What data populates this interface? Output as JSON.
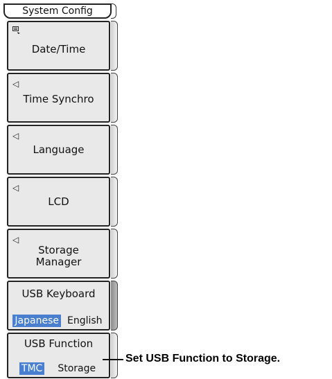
{
  "menu": {
    "title": "System Config",
    "items": [
      {
        "label": "Date/Time",
        "icon": "keyboard-icon"
      },
      {
        "label": "Time Synchro",
        "icon": "triangle-left-icon"
      },
      {
        "label": "Language",
        "icon": "triangle-left-icon"
      },
      {
        "label": "LCD",
        "icon": "triangle-left-icon"
      },
      {
        "label": "Storage\nManager",
        "icon": "triangle-left-icon"
      }
    ],
    "usb_keyboard": {
      "label": "USB Keyboard",
      "options": [
        "Japanese",
        "English"
      ],
      "selected": "Japanese"
    },
    "usb_function": {
      "label": "USB Function",
      "options": [
        "TMC",
        "Storage"
      ],
      "selected": "TMC"
    }
  },
  "glyphs": {
    "triangle": "◁"
  },
  "annotation": {
    "text": "Set USB Function to Storage."
  },
  "colors": {
    "selected_bg": "#4a7fcf"
  }
}
